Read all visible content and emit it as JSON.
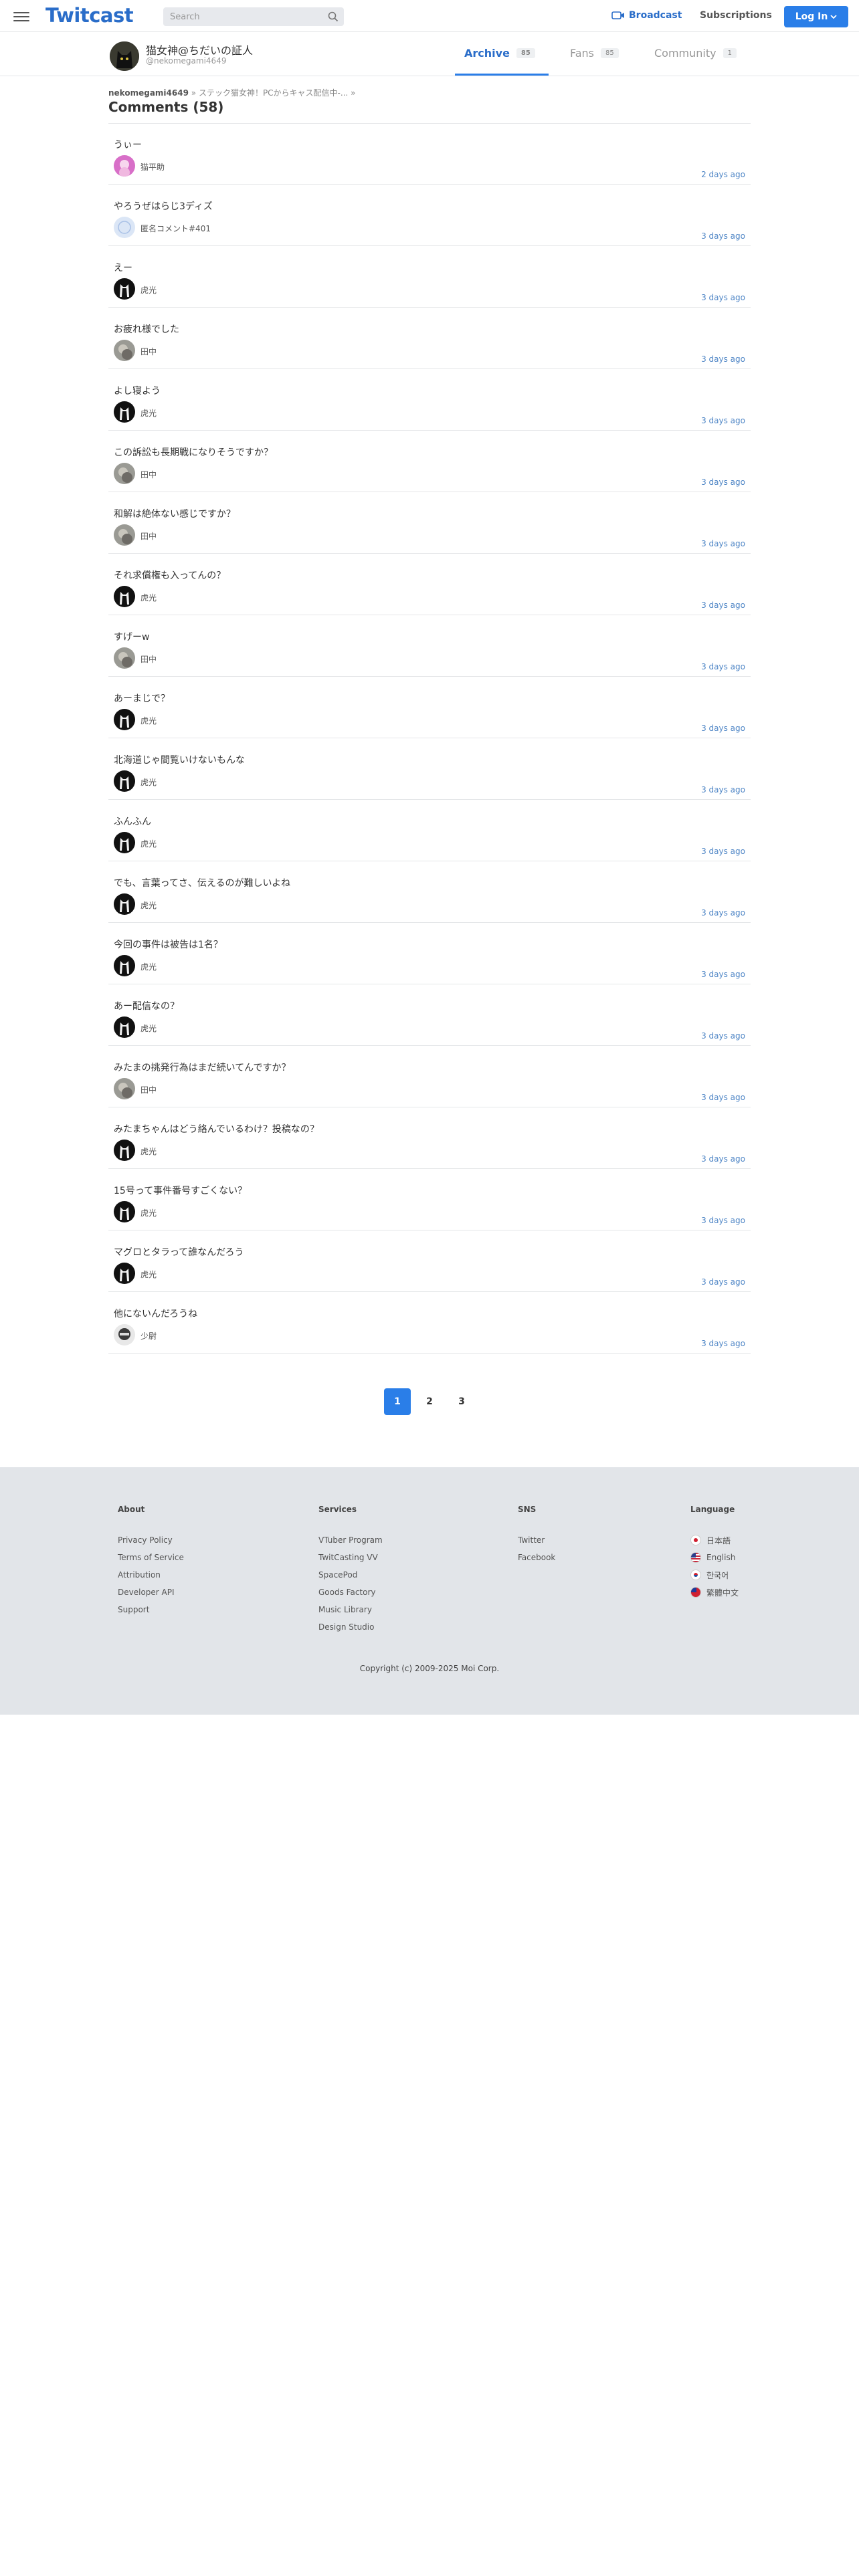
{
  "header": {
    "logo": "Twitcast",
    "search_placeholder": "Search",
    "broadcast": "Broadcast",
    "subscriptions": "Subscriptions",
    "login": "Log In"
  },
  "profile": {
    "name": "猫女神@ちだいの証人",
    "handle": "@nekomegami4649",
    "tabs": [
      {
        "label": "Archive",
        "count": "85"
      },
      {
        "label": "Fans",
        "count": "85"
      },
      {
        "label": "Community",
        "count": "1"
      }
    ]
  },
  "breadcrumb": {
    "user": "nekomegami4649",
    "sep1": "»",
    "movie": "ステック猫女神！PCからキャス配信中-...",
    "sep2": "»"
  },
  "comments_title": "Comments (58)",
  "comments": [
    {
      "text": "うぃー",
      "user": "猫平助",
      "time": "2 days ago",
      "avatar": "pink"
    },
    {
      "text": "やろうぜはらじ3ディズ",
      "user": "匿名コメント#401",
      "time": "3 days ago",
      "avatar": "anon"
    },
    {
      "text": "えー",
      "user": "虎光",
      "time": "3 days ago",
      "avatar": "cat"
    },
    {
      "text": "お疲れ様でした",
      "user": "田中",
      "time": "3 days ago",
      "avatar": "gray"
    },
    {
      "text": "よし寝よう",
      "user": "虎光",
      "time": "3 days ago",
      "avatar": "cat"
    },
    {
      "text": "この訴訟も長期戦になりそうですか？",
      "user": "田中",
      "time": "3 days ago",
      "avatar": "gray"
    },
    {
      "text": "和解は絶体ない感じですか？",
      "user": "田中",
      "time": "3 days ago",
      "avatar": "gray"
    },
    {
      "text": "それ求償権も入ってんの？",
      "user": "虎光",
      "time": "3 days ago",
      "avatar": "cat"
    },
    {
      "text": "すげーw",
      "user": "田中",
      "time": "3 days ago",
      "avatar": "gray"
    },
    {
      "text": "あーまじで？",
      "user": "虎光",
      "time": "3 days ago",
      "avatar": "cat"
    },
    {
      "text": "北海道じゃ間覧いけないもんな",
      "user": "虎光",
      "time": "3 days ago",
      "avatar": "cat"
    },
    {
      "text": "ふんふん",
      "user": "虎光",
      "time": "3 days ago",
      "avatar": "cat"
    },
    {
      "text": "でも、言葉ってさ、伝えるのが難しいよね",
      "user": "虎光",
      "time": "3 days ago",
      "avatar": "cat"
    },
    {
      "text": "今回の事件は被告は1名？",
      "user": "虎光",
      "time": "3 days ago",
      "avatar": "cat"
    },
    {
      "text": "あー配信なの？",
      "user": "虎光",
      "time": "3 days ago",
      "avatar": "cat"
    },
    {
      "text": "みたまの挑発行為はまだ続いてんですか？",
      "user": "田中",
      "time": "3 days ago",
      "avatar": "gray"
    },
    {
      "text": "みたまちゃんはどう絡んでいるわけ？投稿なの？",
      "user": "虎光",
      "time": "3 days ago",
      "avatar": "cat"
    },
    {
      "text": "15号って事件番号すごくない？",
      "user": "虎光",
      "time": "3 days ago",
      "avatar": "cat"
    },
    {
      "text": "マグロとタラって誰なんだろう",
      "user": "虎光",
      "time": "3 days ago",
      "avatar": "cat"
    },
    {
      "text": "他にないんだろうね",
      "user": "少尉",
      "time": "3 days ago",
      "avatar": "kid"
    }
  ],
  "pagination": [
    "1",
    "2",
    "3"
  ],
  "footer": {
    "about": {
      "title": "About",
      "links": [
        "Privacy Policy",
        "Terms of Service",
        "Attribution",
        "Developer API",
        "Support"
      ]
    },
    "services": {
      "title": "Services",
      "links": [
        "VTuber Program",
        "TwitCasting VV",
        "SpacePod",
        "Goods Factory",
        "Music Library",
        "Design Studio"
      ]
    },
    "sns": {
      "title": "SNS",
      "links": [
        "Twitter",
        "Facebook"
      ]
    },
    "language": {
      "title": "Language",
      "links": [
        "日本語",
        "English",
        "한국어",
        "繁體中文"
      ]
    },
    "copyright": "Copyright (c) 2009-2025 Moi Corp."
  },
  "colors": {
    "accent": "#2a7ee8",
    "link": "#4f86c6",
    "footer_bg": "#e2e5e9"
  }
}
